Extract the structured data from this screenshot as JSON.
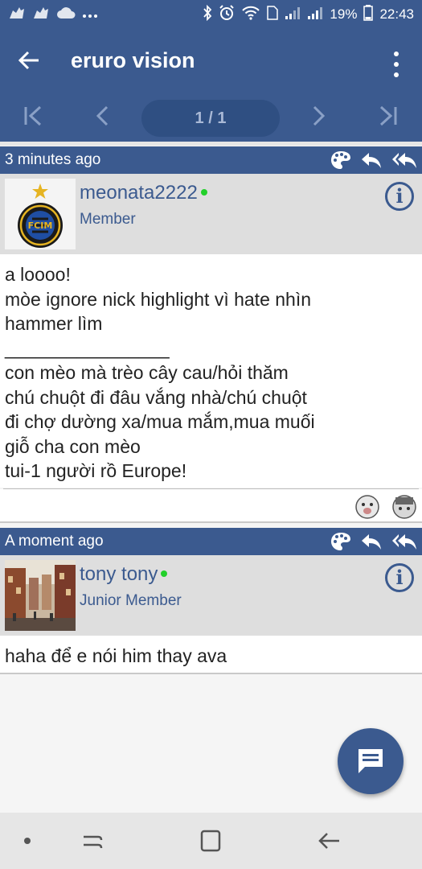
{
  "status_bar": {
    "battery": "19%",
    "time": "22:43"
  },
  "app_bar": {
    "title": "eruro vision"
  },
  "pager": {
    "page_indicator": "1 / 1"
  },
  "posts": [
    {
      "time": "3 minutes ago",
      "username": "meonata2222",
      "role": "Member",
      "body": "a loooo!\nmòe ignore nick highlight vì hate nhìn\nhammer lìm",
      "signature_rule": "________________",
      "signature": "con mèo mà trèo cây cau/hỏi thăm\nchú chuột đi đâu vắng nhà/chú chuột\nđi chợ dường xa/mua mắm,mua muối\ngiỗ cha con mèo\ntui-1 người rồ Europe!"
    },
    {
      "time": "A moment ago",
      "username": "tony tony",
      "role": "Junior Member",
      "body": "haha để e nói him thay ava"
    }
  ],
  "colors": {
    "brand": "#3b5a8f",
    "online": "#22d02a"
  }
}
